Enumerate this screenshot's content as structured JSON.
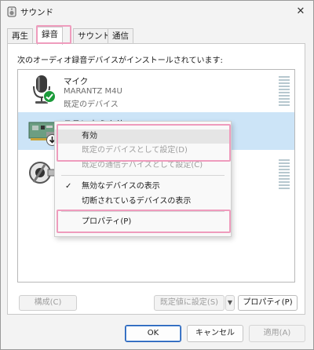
{
  "window": {
    "title": "サウンド",
    "close_glyph": "✕"
  },
  "tabs": [
    {
      "label": "再生"
    },
    {
      "label": "録音"
    },
    {
      "label": "サウンド"
    },
    {
      "label": "通信"
    }
  ],
  "panel": {
    "instruction": "次のオーディオ録音デバイスがインストールされています:"
  },
  "devices": [
    {
      "name": "マイク",
      "line1": "MARANTZ M4U",
      "line2": "既定のデバイス",
      "icon": "microphone-icon",
      "status_icon": "default-check-icon"
    },
    {
      "name": "ステレオ ミキサー",
      "line1": "",
      "line2": "",
      "icon": "sound-card-icon",
      "status_icon": "disabled-down-arrow-icon"
    },
    {
      "name": "",
      "line1": "",
      "line2": "",
      "icon": "line-in-jack-icon"
    }
  ],
  "context_menu": {
    "enable": "有効",
    "set_default": "既定のデバイスとして設定(D)",
    "set_default_comm": "既定の通信デバイスとして設定(C)",
    "show_disabled": "無効なデバイスの表示",
    "show_disconnected": "切断されているデバイスの表示",
    "properties": "プロパティ(P)",
    "checkmark": "✓"
  },
  "panel_buttons": {
    "configure": "構成(C)",
    "set_default": "既定値に設定(S)",
    "dropdown_glyph": "▼",
    "properties": "プロパティ(P)"
  },
  "dialog_buttons": {
    "ok": "OK",
    "cancel": "キャンセル",
    "apply": "適用(A)"
  },
  "colors": {
    "highlight_box": "#ef9cbd",
    "selected_row": "#cce4f7",
    "default_check": "#1b9b3a",
    "ok_border": "#1d5bb6"
  }
}
